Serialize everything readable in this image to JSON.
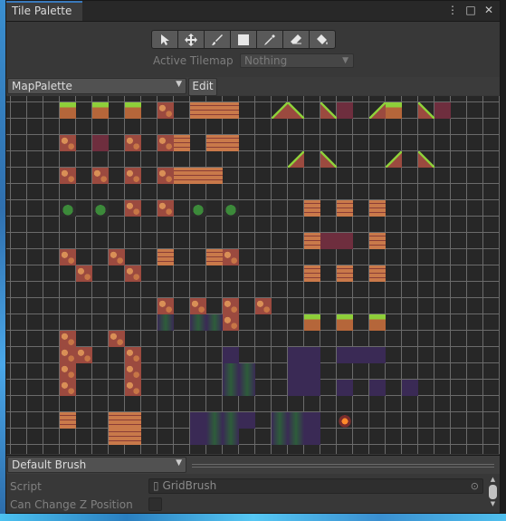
{
  "window": {
    "tab_title": "Tile Palette"
  },
  "tab_icons": [
    "⋮",
    "□",
    "✕"
  ],
  "toolbar": {
    "tools": [
      {
        "name": "select-tool",
        "icon": "arrow-cursor-icon"
      },
      {
        "name": "move-tool",
        "icon": "move-arrows-icon"
      },
      {
        "name": "paint-tool",
        "icon": "brush-icon"
      },
      {
        "name": "box-fill-tool",
        "icon": "square-icon"
      },
      {
        "name": "picker-tool",
        "icon": "eyedropper-icon"
      },
      {
        "name": "eraser-tool",
        "icon": "eraser-icon"
      },
      {
        "name": "fill-tool",
        "icon": "paint-bucket-icon"
      }
    ]
  },
  "active_tilemap": {
    "label": "Active Tilemap",
    "value": "Nothing"
  },
  "palette": {
    "selected": "MapPalette",
    "edit_label": "Edit"
  },
  "brush": {
    "selected": "Default Brush"
  },
  "inspector": {
    "script_label": "Script",
    "script_value": "GridBrush",
    "z_label": "Can Change Z Position",
    "z_checked": false
  }
}
